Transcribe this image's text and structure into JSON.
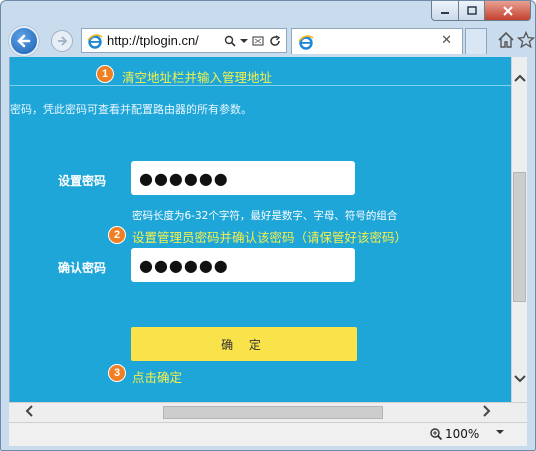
{
  "browser": {
    "url": "http://tplogin.cn/",
    "zoom": "100%"
  },
  "colors": {
    "page_background": "#1fa6d9",
    "annotation_text": "#f5f04b",
    "badge": "#f07f23",
    "confirm_button": "#f9e24a"
  },
  "page": {
    "step1": {
      "number": "1",
      "text": "清空地址栏并输入管理地址"
    },
    "description": "密码，凭此密码可查看并配置路由器的所有参数。",
    "set_password": {
      "label": "设置密码",
      "value": "●●●●●●"
    },
    "hint": "密码长度为6-32个字符，最好是数字、字母、符号的组合",
    "step2": {
      "number": "2",
      "text": "设置管理员密码并确认该密码（请保管好该密码）"
    },
    "confirm_password": {
      "label": "确认密码",
      "value": "●●●●●●"
    },
    "confirm_button": "确 定",
    "step3": {
      "number": "3",
      "text": "点击确定"
    }
  }
}
